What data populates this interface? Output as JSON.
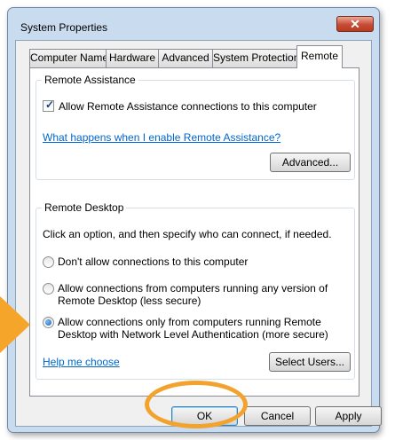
{
  "window": {
    "title": "System Properties",
    "close_glyph": "✕"
  },
  "tabs": [
    {
      "label": "Computer Name",
      "active": false
    },
    {
      "label": "Hardware",
      "active": false
    },
    {
      "label": "Advanced",
      "active": false
    },
    {
      "label": "System Protection",
      "active": false
    },
    {
      "label": "Remote",
      "active": true
    }
  ],
  "remote_assistance": {
    "group_title": "Remote Assistance",
    "allow_checkbox_label": "Allow Remote Assistance connections to this computer",
    "allow_checked": true,
    "help_link": "What happens when I enable Remote Assistance?",
    "advanced_button": "Advanced..."
  },
  "remote_desktop": {
    "group_title": "Remote Desktop",
    "instructions": "Click an option, and then specify who can connect, if needed.",
    "options": [
      {
        "line1": "Don't allow connections to this computer",
        "line2": "",
        "selected": false
      },
      {
        "line1": "Allow connections from computers running any version of",
        "line2": "Remote Desktop (less secure)",
        "selected": false
      },
      {
        "line1": "Allow connections only from computers running Remote",
        "line2": "Desktop with Network Level Authentication (more secure)",
        "selected": true
      }
    ],
    "help_link": "Help me choose",
    "select_users_button": "Select Users..."
  },
  "footer": {
    "ok": "OK",
    "cancel": "Cancel",
    "apply": "Apply"
  },
  "colors": {
    "highlight": "#f3a32d",
    "link": "#0066cc",
    "titlebar": "#c9dcef"
  },
  "icons": {
    "close": "close-icon",
    "checkmark": "checkmark-icon",
    "radio": "radio-selected-icon"
  }
}
